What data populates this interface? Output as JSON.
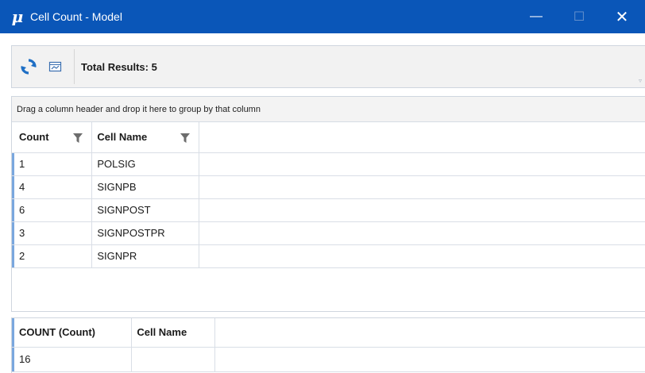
{
  "window": {
    "app_icon_glyph": "μ",
    "title": "Cell Count - Model",
    "min_glyph": "—",
    "max_glyph": "☐",
    "close_glyph": "✕",
    "titlebar_color": "#0a56b8"
  },
  "toolbar": {
    "refresh_icon": "refresh-icon",
    "report_icon": "report-icon",
    "total_results_label": "Total Results: 5",
    "overflow_glyph": "▿"
  },
  "grid": {
    "group_hint": "Drag a column header and drop it here to group by that column",
    "columns": [
      {
        "label": "Count",
        "filter_icon": "filter-icon"
      },
      {
        "label": "Cell Name",
        "filter_icon": "filter-icon"
      }
    ],
    "rows": [
      {
        "count": "1",
        "cell_name": "POLSIG"
      },
      {
        "count": "4",
        "cell_name": "SIGNPB"
      },
      {
        "count": "6",
        "cell_name": "SIGNPOST"
      },
      {
        "count": "3",
        "cell_name": "SIGNPOSTPR"
      },
      {
        "count": "2",
        "cell_name": "SIGNPR"
      }
    ]
  },
  "summary": {
    "columns": [
      "COUNT (Count)",
      "Cell Name"
    ],
    "rows": [
      {
        "count_total": "16",
        "cell_name": ""
      }
    ]
  }
}
